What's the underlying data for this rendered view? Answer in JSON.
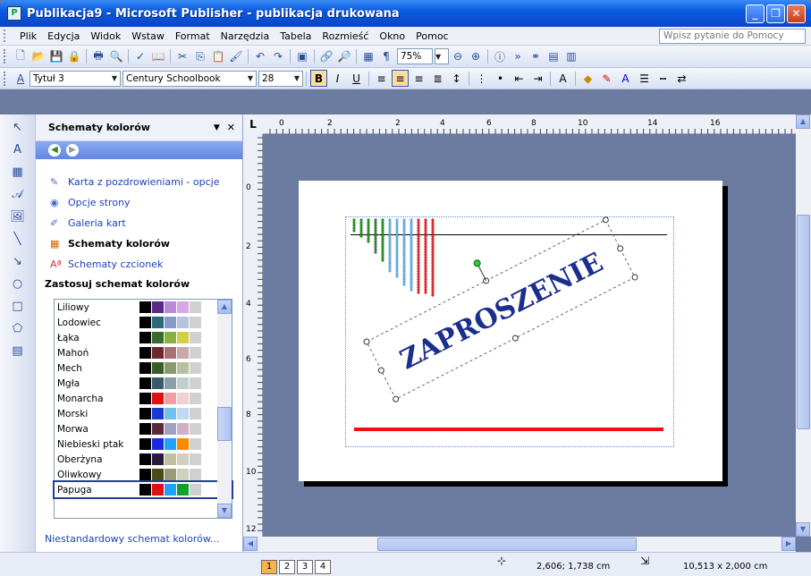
{
  "window": {
    "title": "Publikacja9 - Microsoft Publisher - publikacja drukowana"
  },
  "menu": {
    "items": [
      "Plik",
      "Edycja",
      "Widok",
      "Wstaw",
      "Format",
      "Narzędzia",
      "Tabela",
      "Rozmieść",
      "Okno",
      "Pomoc"
    ],
    "help_placeholder": "Wpisz pytanie do Pomocy"
  },
  "standard": {
    "zoom": "75%"
  },
  "formatting": {
    "style": "Tytuł 3",
    "font": "Century Schoolbook",
    "size": "28"
  },
  "taskpane": {
    "title": "Schematy kolorów",
    "links": [
      "Karta z pozdrowieniami - opcje",
      "Opcje strony",
      "Galeria kart",
      "Schematy kolorów",
      "Schematy czcionek"
    ],
    "section": "Zastosuj schemat kolorów",
    "schemes": [
      {
        "name": "Liliowy",
        "colors": [
          "#000000",
          "#5a2a8a",
          "#b98ad8",
          "#d7a9e3",
          "#d0d0d0"
        ]
      },
      {
        "name": "Lodowiec",
        "colors": [
          "#000000",
          "#2a6a78",
          "#8a9ac8",
          "#b8c4dc",
          "#d0d0d0"
        ]
      },
      {
        "name": "Łąka",
        "colors": [
          "#000000",
          "#3a6a2a",
          "#8ab040",
          "#d0d040",
          "#d0d0d0"
        ]
      },
      {
        "name": "Mahoń",
        "colors": [
          "#000000",
          "#6a2a2a",
          "#a87070",
          "#c8a8a8",
          "#d0d0d0"
        ]
      },
      {
        "name": "Mech",
        "colors": [
          "#000000",
          "#3a5a2a",
          "#8a9a6a",
          "#b8c0a0",
          "#d0d0d0"
        ]
      },
      {
        "name": "Mgła",
        "colors": [
          "#000000",
          "#3a5a6a",
          "#8aa0a8",
          "#c0d0d0",
          "#d0d0d0"
        ]
      },
      {
        "name": "Monarcha",
        "colors": [
          "#000000",
          "#e01010",
          "#f0a0a0",
          "#f0d0d0",
          "#d0d0d0"
        ]
      },
      {
        "name": "Morski",
        "colors": [
          "#000000",
          "#1a3ad0",
          "#70c0f0",
          "#c0d8f0",
          "#d0d0d0"
        ]
      },
      {
        "name": "Morwa",
        "colors": [
          "#000000",
          "#5a2a3a",
          "#a0a0c0",
          "#d0b0c0",
          "#d0d0d0"
        ]
      },
      {
        "name": "Niebieski ptak",
        "colors": [
          "#000000",
          "#1a2ae0",
          "#20a0ff",
          "#ff8800",
          "#d0d0d0"
        ]
      },
      {
        "name": "Oberżyna",
        "colors": [
          "#000000",
          "#2a1a3a",
          "#c0c0a0",
          "#d0d0c0",
          "#d0d0d0"
        ]
      },
      {
        "name": "Oliwkowy",
        "colors": [
          "#000000",
          "#4a4a1a",
          "#9a9a7a",
          "#d0d0c0",
          "#d0d0d0"
        ]
      },
      {
        "name": "Papuga",
        "colors": [
          "#000000",
          "#e01010",
          "#20a0ff",
          "#10a030",
          "#d0d0d0"
        ]
      }
    ],
    "custom_link": "Niestandardowy schemat kolorów..."
  },
  "ruler": {
    "corner": "L",
    "h_ticks": [
      "0",
      "2",
      "2",
      "4",
      "6",
      "8",
      "10",
      "14",
      "16"
    ],
    "v_ticks": [
      "0",
      "2",
      "4",
      "6",
      "8",
      "10",
      "12"
    ]
  },
  "document": {
    "headline": "ZAPROSZENIE"
  },
  "status": {
    "pages": [
      "1",
      "2",
      "3",
      "4"
    ],
    "position": "2,606; 1,738 cm",
    "size": "10,513 x  2,000 cm"
  }
}
